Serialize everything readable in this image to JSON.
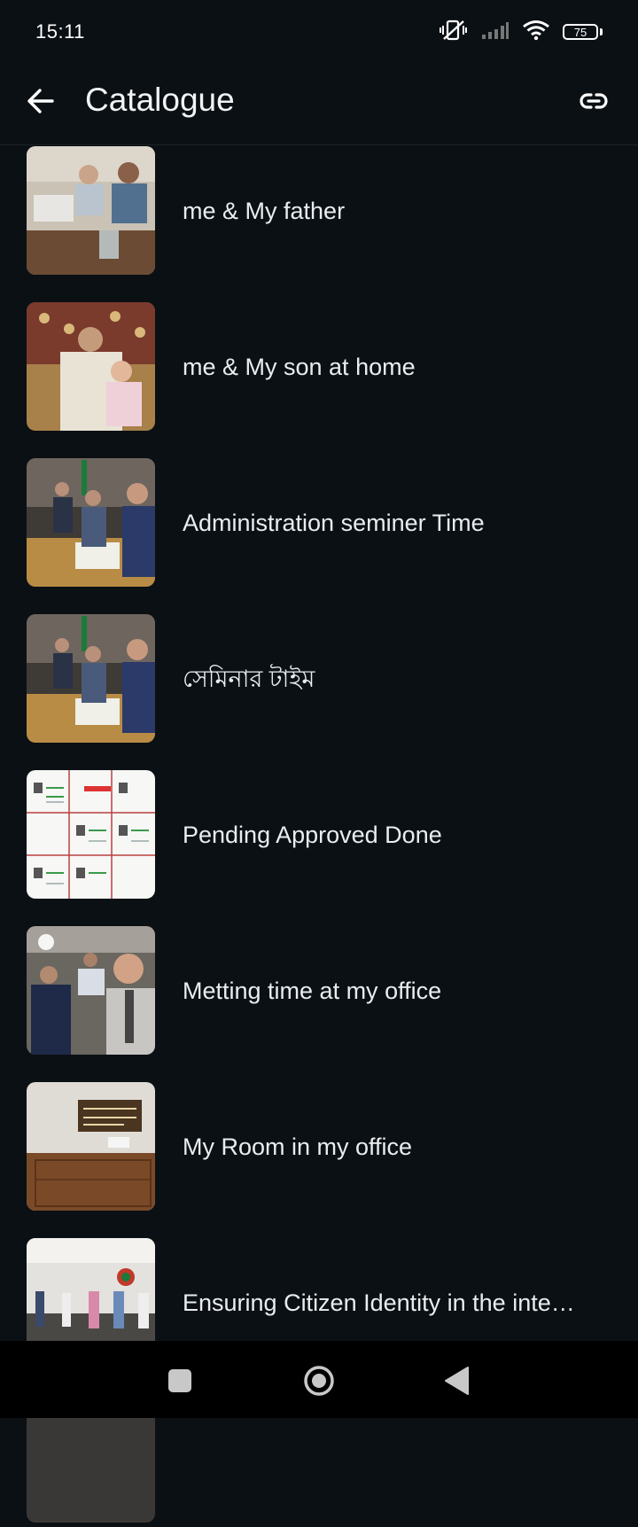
{
  "status_bar": {
    "time": "15:11",
    "battery": "75",
    "icons": [
      "mute-vibrate-icon",
      "signal-icon",
      "wifi-icon",
      "battery-icon"
    ]
  },
  "app_bar": {
    "title": "Catalogue",
    "back_icon": "arrow-left-icon",
    "link_icon": "link-icon"
  },
  "items": [
    {
      "label": "me & My father",
      "thumb": "office-desk-photo"
    },
    {
      "label": "me & My son at home",
      "thumb": "home-photo"
    },
    {
      "label": "Administration seminer Time",
      "thumb": "seminar-photo"
    },
    {
      "label": "সেমিনার টাইম",
      "thumb": "seminar-photo"
    },
    {
      "label": "Pending Approved Done",
      "thumb": "document-grid-photo"
    },
    {
      "label": "Metting time at my office",
      "thumb": "meeting-photo"
    },
    {
      "label": "My Room in my office",
      "thumb": "office-door-photo"
    },
    {
      "label": "Ensuring Citizen Identity in the inte…",
      "thumb": "conference-photo"
    }
  ],
  "colors": {
    "background": "#0b1014",
    "text": "#e9edef",
    "nav_background": "#000000"
  }
}
